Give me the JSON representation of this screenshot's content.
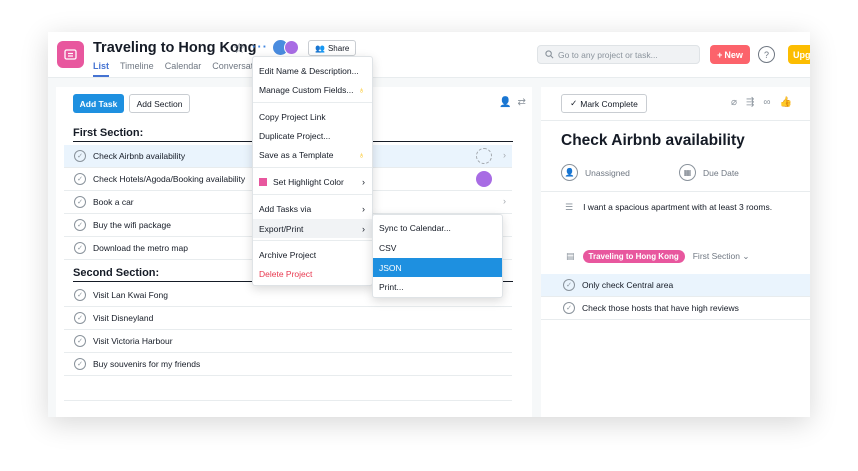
{
  "header": {
    "project_title": "Traveling to Hong Kong",
    "share_label": "Share",
    "tabs": [
      {
        "label": "List",
        "active": true
      },
      {
        "label": "Timeline",
        "active": false
      },
      {
        "label": "Calendar",
        "active": false
      },
      {
        "label": "Conversations",
        "active": false
      }
    ],
    "search_placeholder": "Go to any project or task...",
    "new_label": "New",
    "help_label": "?",
    "upgrade_label": "Upg",
    "brand_color": "#e8579e"
  },
  "list": {
    "add_task": "Add Task",
    "add_section": "Add Section",
    "sections": [
      {
        "title": "First Section:",
        "tasks": [
          {
            "name": "Check Airbnb availability",
            "highlighted": true,
            "assignee": "empty"
          },
          {
            "name": "Check Hotels/Agoda/Booking availability",
            "highlighted": false,
            "assignee": "purple"
          },
          {
            "name": "Book a car",
            "highlighted": false,
            "assignee": "none"
          },
          {
            "name": "Buy the wifi package",
            "highlighted": false,
            "assignee": "none"
          },
          {
            "name": "Download the metro map",
            "highlighted": false,
            "assignee": "none"
          }
        ]
      },
      {
        "title": "Second Section:",
        "tasks": [
          {
            "name": "Visit Lan Kwai Fong",
            "highlighted": false,
            "assignee": "none"
          },
          {
            "name": "Visit Disneyland",
            "highlighted": false,
            "assignee": "none"
          },
          {
            "name": "Visit Victoria Harbour",
            "highlighted": false,
            "assignee": "none"
          },
          {
            "name": "Buy souvenirs for my friends",
            "highlighted": false,
            "assignee": "none"
          }
        ]
      }
    ]
  },
  "detail": {
    "mark_complete": "Mark Complete",
    "title": "Check Airbnb availability",
    "assignee": "Unassigned",
    "due_date": "Due Date",
    "description": "I want a spacious apartment with at least 3 rooms.",
    "project_tag": "Traveling to Hong Kong",
    "section": "First Section",
    "subtasks": [
      {
        "name": "Only check Central area",
        "highlighted": true
      },
      {
        "name": "Check those hosts that have high reviews",
        "highlighted": false
      }
    ]
  },
  "menu": {
    "items": [
      {
        "label": "Edit Name & Description..."
      },
      {
        "label": "Manage Custom Fields...",
        "badge": true
      },
      {
        "label": "Copy Project Link"
      },
      {
        "label": "Duplicate Project..."
      },
      {
        "label": "Save as a Template",
        "badge": true
      },
      {
        "label": "Set Highlight Color",
        "arrow": true
      },
      {
        "label": "Add Tasks via",
        "arrow": true
      },
      {
        "label": "Export/Print",
        "arrow": true,
        "hover": true
      },
      {
        "label": "Archive Project"
      },
      {
        "label": "Delete Project",
        "danger": true
      }
    ]
  },
  "submenu": {
    "items": [
      {
        "label": "Sync to Calendar..."
      },
      {
        "label": "CSV"
      },
      {
        "label": "JSON",
        "active": true
      },
      {
        "label": "Print..."
      }
    ]
  }
}
